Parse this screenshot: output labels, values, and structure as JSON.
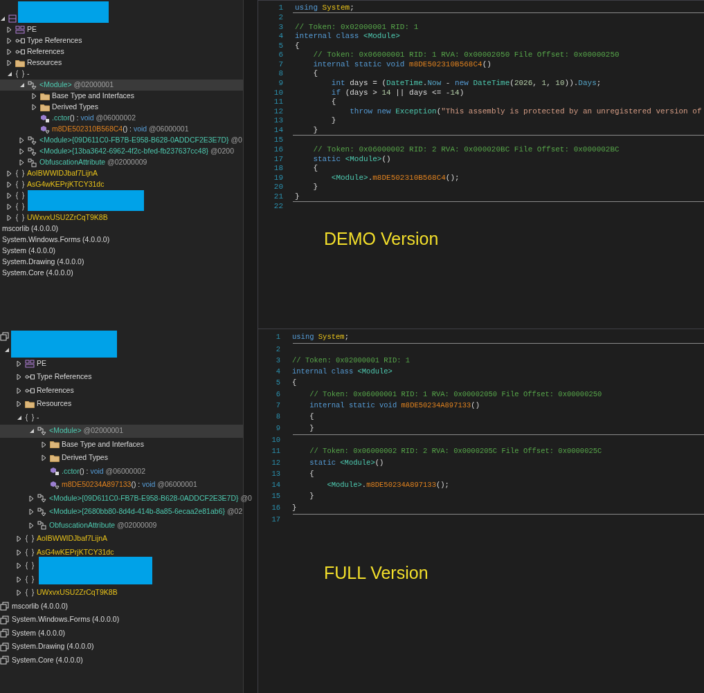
{
  "panes": [
    {
      "tree": [
        {
          "kind": "module",
          "expanded": true,
          "selected": false,
          "children": [
            {
              "kind": "pe",
              "expanded": false,
              "selected": false,
              "label": [
                {
                  "text": "PE",
                  "kind": "plain"
                }
              ]
            },
            {
              "kind": "reference",
              "expanded": false,
              "selected": false,
              "label": [
                {
                  "text": "Type References",
                  "kind": "plain"
                }
              ]
            },
            {
              "kind": "reference",
              "expanded": false,
              "selected": false,
              "label": [
                {
                  "text": "References",
                  "kind": "plain"
                }
              ]
            },
            {
              "kind": "folder",
              "expanded": false,
              "selected": false,
              "label": [
                {
                  "text": "Resources",
                  "kind": "plain"
                }
              ]
            },
            {
              "kind": "namespace",
              "expanded": true,
              "selected": false,
              "label": [
                {
                  "text": "-",
                  "kind": "plain"
                }
              ],
              "children": [
                {
                  "kind": "class",
                  "expanded": true,
                  "selected": true,
                  "label": [
                    {
                      "text": "<Module>",
                      "kind": "type"
                    },
                    {
                      "text": " @02000001",
                      "kind": "token"
                    }
                  ],
                  "children": [
                    {
                      "kind": "folder",
                      "expanded": false,
                      "selected": false,
                      "label": [
                        {
                          "text": "Base Type and Interfaces",
                          "kind": "plain"
                        }
                      ]
                    },
                    {
                      "kind": "folder",
                      "expanded": false,
                      "selected": false,
                      "label": [
                        {
                          "text": "Derived Types",
                          "kind": "plain"
                        }
                      ]
                    },
                    {
                      "kind": "ctor",
                      "selected": false,
                      "label": [
                        {
                          "text": ".cctor",
                          "kind": "ctor"
                        },
                        {
                          "text": "() : ",
                          "kind": "plain"
                        },
                        {
                          "text": "void",
                          "kind": "keyword"
                        },
                        {
                          "text": " @06000002",
                          "kind": "token"
                        }
                      ]
                    },
                    {
                      "kind": "method",
                      "selected": false,
                      "label": [
                        {
                          "text": "m8DE502310B568C4",
                          "kind": "method"
                        },
                        {
                          "text": "() : ",
                          "kind": "plain"
                        },
                        {
                          "text": "void",
                          "kind": "keyword"
                        },
                        {
                          "text": " @06000001",
                          "kind": "token"
                        }
                      ]
                    }
                  ]
                },
                {
                  "kind": "class",
                  "expanded": false,
                  "selected": false,
                  "label": [
                    {
                      "text": "<Module>{09D611C0-FB7B-E958-B628-0ADDCF2E3E7D}",
                      "kind": "type"
                    },
                    {
                      "text": " @0",
                      "kind": "token"
                    }
                  ]
                },
                {
                  "kind": "class",
                  "expanded": false,
                  "selected": false,
                  "label": [
                    {
                      "text": "<Module>{13ba3642-6962-4f2c-bfed-fb237637cc48}",
                      "kind": "type"
                    },
                    {
                      "text": " @0200",
                      "kind": "token"
                    }
                  ]
                },
                {
                  "kind": "attribute",
                  "expanded": false,
                  "selected": false,
                  "label": [
                    {
                      "text": "ObfuscationAttribute",
                      "kind": "type"
                    },
                    {
                      "text": " @02000009",
                      "kind": "token"
                    }
                  ]
                }
              ]
            },
            {
              "kind": "namespace",
              "expanded": false,
              "selected": false,
              "label": [
                {
                  "text": "AoIBWWIDJbaf7LijnA",
                  "kind": "namespace"
                }
              ]
            },
            {
              "kind": "namespace",
              "expanded": false,
              "selected": false,
              "label": [
                {
                  "text": "AsG4wKEPrjKTCY31dc",
                  "kind": "namespace"
                }
              ]
            },
            {
              "kind": "namespace",
              "expanded": false,
              "selected": false
            },
            {
              "kind": "namespace",
              "expanded": false,
              "selected": false
            },
            {
              "kind": "namespace",
              "expanded": false,
              "selected": false,
              "label": [
                {
                  "text": "UWxvxUSU2ZrCqT9K8B",
                  "kind": "namespace"
                }
              ]
            }
          ]
        },
        {
          "selected": false,
          "label": [
            {
              "text": "mscorlib (4.0.0.0)",
              "kind": "plain"
            }
          ]
        },
        {
          "selected": false,
          "label": [
            {
              "text": "System.Windows.Forms (4.0.0.0)",
              "kind": "plain"
            }
          ]
        },
        {
          "selected": false,
          "label": [
            {
              "text": "System (4.0.0.0)",
              "kind": "plain"
            }
          ]
        },
        {
          "selected": false,
          "label": [
            {
              "text": "System.Drawing (4.0.0.0)",
              "kind": "plain"
            }
          ]
        },
        {
          "selected": false,
          "label": [
            {
              "text": "System.Core (4.0.0.0)",
              "kind": "plain"
            }
          ]
        }
      ],
      "code": [
        {
          "n": "1",
          "separator": true,
          "tokens": [
            {
              "text": "using ",
              "kind": "kw"
            },
            {
              "text": "System",
              "kind": "ns"
            },
            {
              "text": ";",
              "kind": "plain"
            }
          ]
        },
        {
          "n": "2",
          "separator": false
        },
        {
          "n": "3",
          "separator": false,
          "tokens": [
            {
              "text": "// Token: 0x02000001 RID: 1",
              "kind": "comment"
            }
          ]
        },
        {
          "n": "4",
          "separator": false,
          "tokens": [
            {
              "text": "internal class ",
              "kind": "kw"
            },
            {
              "text": "<Module>",
              "kind": "type"
            }
          ]
        },
        {
          "n": "5",
          "separator": false,
          "tokens": [
            {
              "text": "{",
              "kind": "plain"
            }
          ]
        },
        {
          "n": "6",
          "separator": false,
          "tokens": [
            {
              "text": "    // Token: 0x06000001 RID: 1 RVA: 0x00002050 File Offset: 0x00000250",
              "kind": "comment"
            }
          ]
        },
        {
          "n": "7",
          "separator": false,
          "tokens": [
            {
              "text": "    internal static void ",
              "kind": "kw"
            },
            {
              "text": "m8DE502310B568C4",
              "kind": "method"
            },
            {
              "text": "()",
              "kind": "plain"
            }
          ]
        },
        {
          "n": "8",
          "separator": false,
          "tokens": [
            {
              "text": "    {",
              "kind": "plain"
            }
          ]
        },
        {
          "n": "9",
          "separator": false,
          "tokens": [
            {
              "text": "        int ",
              "kind": "kw"
            },
            {
              "text": "days = (",
              "kind": "plain"
            },
            {
              "text": "DateTime",
              "kind": "type"
            },
            {
              "text": ".",
              "kind": "plain"
            },
            {
              "text": "Now",
              "kind": "prop"
            },
            {
              "text": " - ",
              "kind": "plain"
            },
            {
              "text": "new ",
              "kind": "kw"
            },
            {
              "text": "DateTime",
              "kind": "type"
            },
            {
              "text": "(",
              "kind": "plain"
            },
            {
              "text": "2026",
              "kind": "num"
            },
            {
              "text": ", ",
              "kind": "plain"
            },
            {
              "text": "1",
              "kind": "num"
            },
            {
              "text": ", ",
              "kind": "plain"
            },
            {
              "text": "10",
              "kind": "num"
            },
            {
              "text": ")).",
              "kind": "plain"
            },
            {
              "text": "Days",
              "kind": "prop"
            },
            {
              "text": ";",
              "kind": "plain"
            }
          ]
        },
        {
          "n": "10",
          "separator": false,
          "tokens": [
            {
              "text": "        if ",
              "kind": "kw"
            },
            {
              "text": "(days > ",
              "kind": "plain"
            },
            {
              "text": "14",
              "kind": "num"
            },
            {
              "text": " || days <= -",
              "kind": "plain"
            },
            {
              "text": "14",
              "kind": "num"
            },
            {
              "text": ")",
              "kind": "plain"
            }
          ]
        },
        {
          "n": "11",
          "separator": false,
          "tokens": [
            {
              "text": "        {",
              "kind": "plain"
            }
          ]
        },
        {
          "n": "12",
          "separator": false,
          "tokens": [
            {
              "text": "            throw new ",
              "kind": "kw"
            },
            {
              "text": "Exception",
              "kind": "type"
            },
            {
              "text": "(",
              "kind": "plain"
            },
            {
              "text": "\"This assembly is protected by an unregistered version of",
              "kind": "str"
            }
          ]
        },
        {
          "n": "13",
          "separator": false,
          "tokens": [
            {
              "text": "        }",
              "kind": "plain"
            }
          ]
        },
        {
          "n": "14",
          "separator": true,
          "tokens": [
            {
              "text": "    }",
              "kind": "plain"
            }
          ]
        },
        {
          "n": "15",
          "separator": false
        },
        {
          "n": "16",
          "separator": false,
          "tokens": [
            {
              "text": "    // Token: 0x06000002 RID: 2 RVA: 0x000020BC File Offset: 0x000002BC",
              "kind": "comment"
            }
          ]
        },
        {
          "n": "17",
          "separator": false,
          "tokens": [
            {
              "text": "    static ",
              "kind": "kw"
            },
            {
              "text": "<Module>",
              "kind": "type"
            },
            {
              "text": "()",
              "kind": "plain"
            }
          ]
        },
        {
          "n": "18",
          "separator": false,
          "tokens": [
            {
              "text": "    {",
              "kind": "plain"
            }
          ]
        },
        {
          "n": "19",
          "separator": false,
          "tokens": [
            {
              "text": "        <Module>",
              "kind": "type"
            },
            {
              "text": ".",
              "kind": "plain"
            },
            {
              "text": "m8DE502310B568C4",
              "kind": "method"
            },
            {
              "text": "();",
              "kind": "plain"
            }
          ]
        },
        {
          "n": "20",
          "separator": false,
          "tokens": [
            {
              "text": "    }",
              "kind": "plain"
            }
          ]
        },
        {
          "n": "21",
          "separator": true,
          "tokens": [
            {
              "text": "}",
              "kind": "plain"
            }
          ]
        },
        {
          "n": "22",
          "separator": false
        }
      ],
      "caption": "DEMO Version"
    },
    {
      "tree": [
        {
          "kind": "assembly",
          "selected": false,
          "children": [
            {
              "expanded": true,
              "selected": false,
              "children": [
                {
                  "kind": "pe",
                  "expanded": false,
                  "selected": false,
                  "label": [
                    {
                      "text": "PE",
                      "kind": "plain"
                    }
                  ]
                },
                {
                  "kind": "reference",
                  "expanded": false,
                  "selected": false,
                  "label": [
                    {
                      "text": "Type References",
                      "kind": "plain"
                    }
                  ]
                },
                {
                  "kind": "reference",
                  "expanded": false,
                  "selected": false,
                  "label": [
                    {
                      "text": "References",
                      "kind": "plain"
                    }
                  ]
                },
                {
                  "kind": "folder",
                  "expanded": false,
                  "selected": false,
                  "label": [
                    {
                      "text": "Resources",
                      "kind": "plain"
                    }
                  ]
                },
                {
                  "kind": "namespace",
                  "expanded": true,
                  "selected": false,
                  "label": [
                    {
                      "text": "-",
                      "kind": "plain"
                    }
                  ],
                  "children": [
                    {
                      "kind": "class",
                      "expanded": true,
                      "selected": true,
                      "label": [
                        {
                          "text": "<Module>",
                          "kind": "type"
                        },
                        {
                          "text": " @02000001",
                          "kind": "token"
                        }
                      ],
                      "children": [
                        {
                          "kind": "folder",
                          "expanded": false,
                          "selected": false,
                          "label": [
                            {
                              "text": "Base Type and Interfaces",
                              "kind": "plain"
                            }
                          ]
                        },
                        {
                          "kind": "folder",
                          "expanded": false,
                          "selected": false,
                          "label": [
                            {
                              "text": "Derived Types",
                              "kind": "plain"
                            }
                          ]
                        },
                        {
                          "kind": "ctor",
                          "selected": false,
                          "label": [
                            {
                              "text": ".cctor",
                              "kind": "ctor"
                            },
                            {
                              "text": "() : ",
                              "kind": "plain"
                            },
                            {
                              "text": "void",
                              "kind": "keyword"
                            },
                            {
                              "text": " @06000002",
                              "kind": "token"
                            }
                          ]
                        },
                        {
                          "kind": "method",
                          "selected": false,
                          "label": [
                            {
                              "text": "m8DE50234A897133",
                              "kind": "method"
                            },
                            {
                              "text": "() : ",
                              "kind": "plain"
                            },
                            {
                              "text": "void",
                              "kind": "keyword"
                            },
                            {
                              "text": " @06000001",
                              "kind": "token"
                            }
                          ]
                        }
                      ]
                    },
                    {
                      "kind": "class",
                      "expanded": false,
                      "selected": false,
                      "label": [
                        {
                          "text": "<Module>{09D611C0-FB7B-E958-B628-0ADDCF2E3E7D}",
                          "kind": "type"
                        },
                        {
                          "text": " @0",
                          "kind": "token"
                        }
                      ]
                    },
                    {
                      "kind": "class",
                      "expanded": false,
                      "selected": false,
                      "label": [
                        {
                          "text": "<Module>{2680bb80-8d4d-414b-8a85-6ecaa2e81ab6}",
                          "kind": "type"
                        },
                        {
                          "text": " @02",
                          "kind": "token"
                        }
                      ]
                    },
                    {
                      "kind": "attribute",
                      "expanded": false,
                      "selected": false,
                      "label": [
                        {
                          "text": "ObfuscationAttribute",
                          "kind": "type"
                        },
                        {
                          "text": " @02000009",
                          "kind": "token"
                        }
                      ]
                    }
                  ]
                },
                {
                  "kind": "namespace",
                  "expanded": false,
                  "selected": false,
                  "label": [
                    {
                      "text": "AoIBWWIDJbaf7LijnA",
                      "kind": "namespace"
                    }
                  ]
                },
                {
                  "kind": "namespace",
                  "expanded": false,
                  "selected": false,
                  "label": [
                    {
                      "text": "AsG4wKEPrjKTCY31dc",
                      "kind": "namespace"
                    }
                  ]
                },
                {
                  "kind": "namespace",
                  "expanded": false,
                  "selected": false
                },
                {
                  "kind": "namespace",
                  "expanded": false,
                  "selected": false
                },
                {
                  "kind": "namespace",
                  "expanded": false,
                  "selected": false,
                  "label": [
                    {
                      "text": "UWxvxUSU2ZrCqT9K8B",
                      "kind": "namespace"
                    }
                  ]
                }
              ]
            }
          ]
        },
        {
          "kind": "assembly",
          "selected": false,
          "label": [
            {
              "text": "mscorlib (4.0.0.0)",
              "kind": "plain"
            }
          ]
        },
        {
          "kind": "assembly",
          "selected": false,
          "label": [
            {
              "text": "System.Windows.Forms (4.0.0.0)",
              "kind": "plain"
            }
          ]
        },
        {
          "kind": "assembly",
          "selected": false,
          "label": [
            {
              "text": "System (4.0.0.0)",
              "kind": "plain"
            }
          ]
        },
        {
          "kind": "assembly",
          "selected": false,
          "label": [
            {
              "text": "System.Drawing (4.0.0.0)",
              "kind": "plain"
            }
          ]
        },
        {
          "kind": "assembly",
          "selected": false,
          "label": [
            {
              "text": "System.Core (4.0.0.0)",
              "kind": "plain"
            }
          ]
        }
      ],
      "code": [
        {
          "n": "1",
          "separator": true,
          "tokens": [
            {
              "text": "using ",
              "kind": "kw"
            },
            {
              "text": "System",
              "kind": "ns"
            },
            {
              "text": ";",
              "kind": "plain"
            }
          ]
        },
        {
          "n": "2",
          "separator": false
        },
        {
          "n": "3",
          "separator": false,
          "tokens": [
            {
              "text": "// Token: 0x02000001 RID: 1",
              "kind": "comment"
            }
          ]
        },
        {
          "n": "4",
          "separator": false,
          "tokens": [
            {
              "text": "internal class ",
              "kind": "kw"
            },
            {
              "text": "<Module>",
              "kind": "type"
            }
          ]
        },
        {
          "n": "5",
          "separator": false,
          "tokens": [
            {
              "text": "{",
              "kind": "plain"
            }
          ]
        },
        {
          "n": "6",
          "separator": false,
          "tokens": [
            {
              "text": "    // Token: 0x06000001 RID: 1 RVA: 0x00002050 File Offset: 0x00000250",
              "kind": "comment"
            }
          ]
        },
        {
          "n": "7",
          "separator": false,
          "tokens": [
            {
              "text": "    internal static void ",
              "kind": "kw"
            },
            {
              "text": "m8DE50234A897133",
              "kind": "method"
            },
            {
              "text": "()",
              "kind": "plain"
            }
          ]
        },
        {
          "n": "8",
          "separator": false,
          "tokens": [
            {
              "text": "    {",
              "kind": "plain"
            }
          ]
        },
        {
          "n": "9",
          "separator": true,
          "tokens": [
            {
              "text": "    }",
              "kind": "plain"
            }
          ]
        },
        {
          "n": "10",
          "separator": false
        },
        {
          "n": "11",
          "separator": false,
          "tokens": [
            {
              "text": "    // Token: 0x06000002 RID: 2 RVA: 0x0000205C File Offset: 0x0000025C",
              "kind": "comment"
            }
          ]
        },
        {
          "n": "12",
          "separator": false,
          "tokens": [
            {
              "text": "    static ",
              "kind": "kw"
            },
            {
              "text": "<Module>",
              "kind": "type"
            },
            {
              "text": "()",
              "kind": "plain"
            }
          ]
        },
        {
          "n": "13",
          "separator": false,
          "tokens": [
            {
              "text": "    {",
              "kind": "plain"
            }
          ]
        },
        {
          "n": "14",
          "separator": false,
          "tokens": [
            {
              "text": "        <Module>",
              "kind": "type"
            },
            {
              "text": ".",
              "kind": "plain"
            },
            {
              "text": "m8DE50234A897133",
              "kind": "method"
            },
            {
              "text": "();",
              "kind": "plain"
            }
          ]
        },
        {
          "n": "15",
          "separator": false,
          "tokens": [
            {
              "text": "    }",
              "kind": "plain"
            }
          ]
        },
        {
          "n": "16",
          "separator": true,
          "tokens": [
            {
              "text": "}",
              "kind": "plain"
            }
          ]
        },
        {
          "n": "17",
          "separator": false
        }
      ],
      "caption": "FULL Version"
    }
  ]
}
